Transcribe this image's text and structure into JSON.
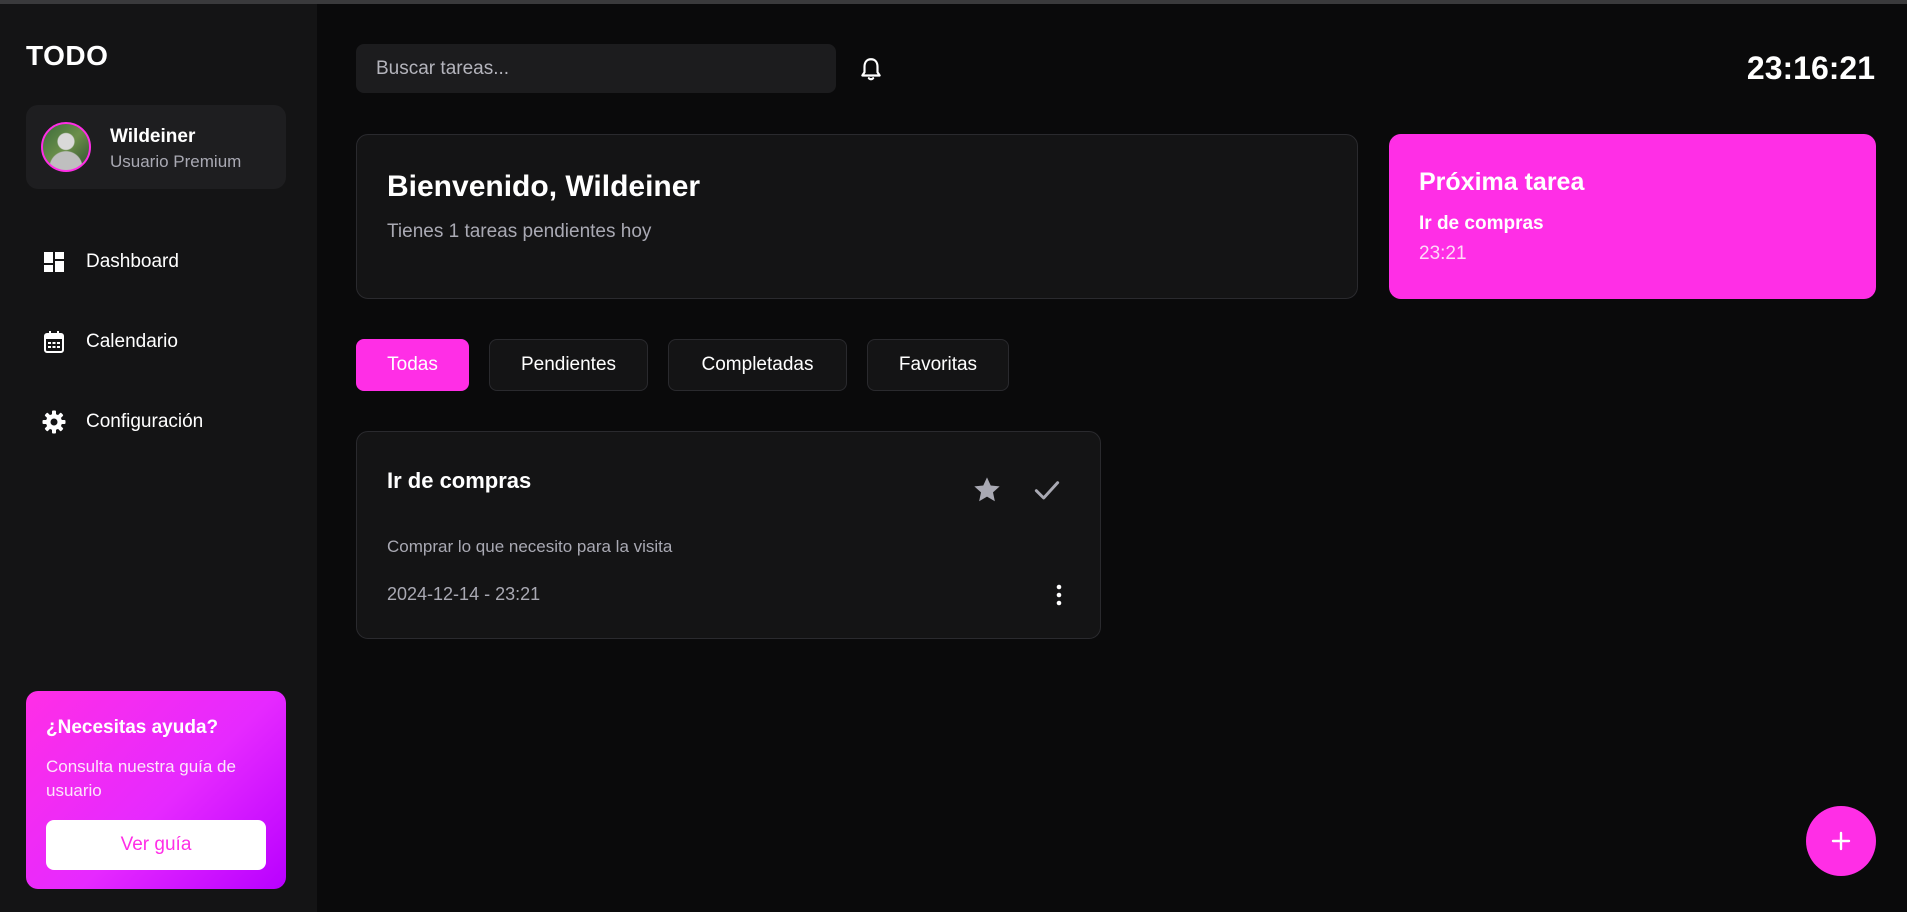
{
  "app": {
    "logo": "TODO"
  },
  "profile": {
    "name": "Wildeiner",
    "plan": "Usuario Premium"
  },
  "sidebar": {
    "items": [
      {
        "label": "Dashboard",
        "icon": "dashboard-icon"
      },
      {
        "label": "Calendario",
        "icon": "calendar-icon"
      },
      {
        "label": "Configuración",
        "icon": "gear-icon"
      }
    ]
  },
  "help": {
    "title": "¿Necesitas ayuda?",
    "text": "Consulta nuestra guía de usuario",
    "button": "Ver guía"
  },
  "search": {
    "placeholder": "Buscar tareas..."
  },
  "clock": "23:16:21",
  "welcome": {
    "title": "Bienvenido, Wildeiner",
    "subtitle": "Tienes 1 tareas pendientes hoy"
  },
  "next_task": {
    "title": "Próxima tarea",
    "task": "Ir de compras",
    "time": "23:21"
  },
  "tabs": [
    {
      "label": "Todas",
      "active": true
    },
    {
      "label": "Pendientes",
      "active": false
    },
    {
      "label": "Completadas",
      "active": false
    },
    {
      "label": "Favoritas",
      "active": false
    }
  ],
  "tasks": [
    {
      "title": "Ir de compras",
      "description": "Comprar lo que necesito para la visita",
      "datetime": "2024-12-14 - 23:21"
    }
  ],
  "colors": {
    "accent": "#ff2ee6",
    "background": "#0a0a0b",
    "sidebar": "#141415",
    "muted_text": "#a9a9b3"
  }
}
